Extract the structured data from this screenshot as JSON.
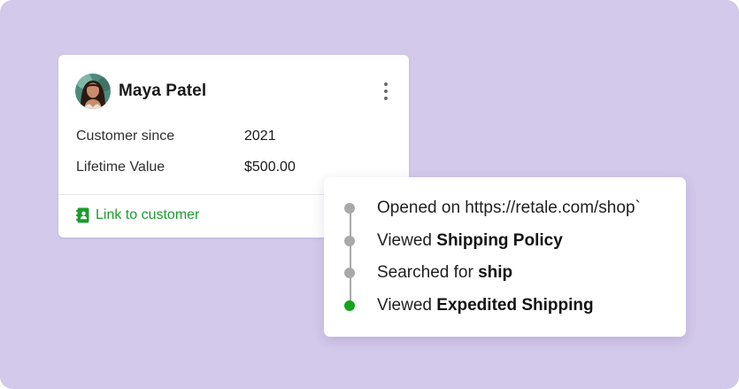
{
  "colors": {
    "background": "#d3c9ea",
    "link_green": "#1c9b2e",
    "active_dot": "#14a41a",
    "inactive_dot": "#a9a9a9"
  },
  "customer": {
    "name": "Maya Patel",
    "details": [
      {
        "label": "Customer since",
        "value": "2021"
      },
      {
        "label": "Lifetime Value",
        "value": "$500.00"
      }
    ],
    "link_label": "Link to customer",
    "link_icon": "contact-book-icon",
    "menu_icon": "more-vertical-icon"
  },
  "activity": [
    {
      "prefix": "Opened on https://retale.com/shop`",
      "emphasis": "",
      "active": false
    },
    {
      "prefix": "Viewed ",
      "emphasis": "Shipping Policy",
      "active": false
    },
    {
      "prefix": "Searched for ",
      "emphasis": "ship",
      "active": false
    },
    {
      "prefix": "Viewed ",
      "emphasis": "Expedited Shipping",
      "active": true
    }
  ]
}
